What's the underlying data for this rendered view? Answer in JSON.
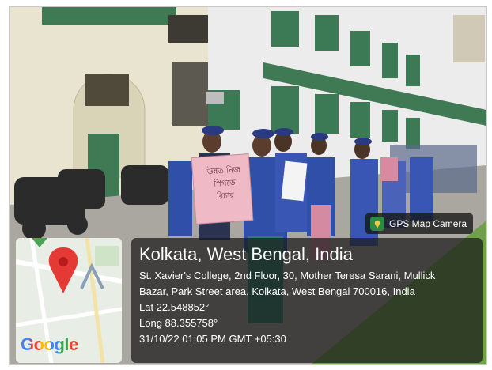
{
  "badge": {
    "label": "GPS Map Camera"
  },
  "location": {
    "title": "Kolkata, West Bengal, India",
    "address_line1": "St. Xavier's College, 2nd Floor, 30, Mother Teresa Sarani, Mullick",
    "address_line2": "Bazar, Park Street area, Kolkata, West Bengal 700016, India",
    "lat": "Lat 22.548852°",
    "long": "Long 88.355758°",
    "datetime": "31/10/22 01:05 PM GMT +05:30"
  },
  "map": {
    "logo": "Google"
  },
  "placards": {
    "left": [
      "উন্নত নিজ",
      "পিগড়ে",
      "রিচার"
    ]
  },
  "colors": {
    "accent_green": "#2d8a3e",
    "map_pin": "#e53935",
    "overlay": "#191919"
  },
  "icons": [
    "gps-map-camera-icon",
    "map-pin-icon",
    "map-arrow-icon"
  ]
}
